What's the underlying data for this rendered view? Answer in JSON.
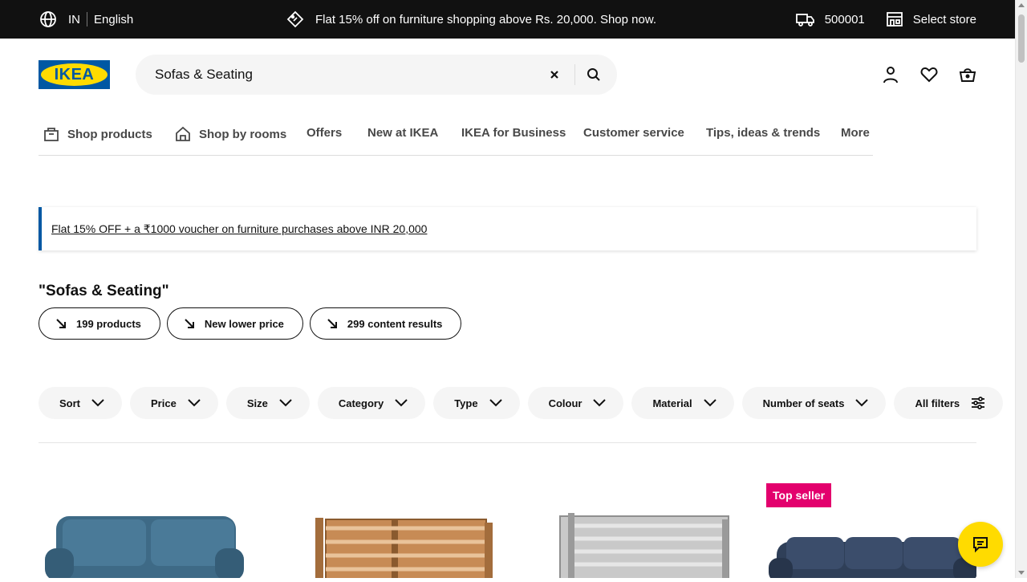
{
  "topbar": {
    "country": "IN",
    "language": "English",
    "promo": "Flat 15% off on furniture shopping above Rs. 20,000. Shop now.",
    "pincode": "500001",
    "store": "Select store"
  },
  "logo": {
    "text": "IKEA"
  },
  "search": {
    "value": "Sofas & Seating",
    "clear_icon": "close-icon",
    "search_icon": "search-icon"
  },
  "nav": {
    "items": [
      {
        "label": "Shop products"
      },
      {
        "label": "Shop by rooms"
      },
      {
        "label": "Offers"
      },
      {
        "label": "New at IKEA"
      },
      {
        "label": "IKEA for Business"
      },
      {
        "label": "Customer service"
      },
      {
        "label": "Tips, ideas & trends"
      },
      {
        "label": "More"
      }
    ]
  },
  "banner": {
    "text": "Flat 15% OFF + a ₹1000 voucher on furniture purchases above INR 20,000"
  },
  "results": {
    "title": "\"Sofas & Seating\"",
    "pills": [
      "199 products",
      "New lower price",
      "299 content results"
    ]
  },
  "filters": [
    "Sort",
    "Price",
    "Size",
    "Category",
    "Type",
    "Colour",
    "Material",
    "Number of seats",
    "All filters"
  ],
  "products": {
    "badge": "Top seller"
  },
  "colors": {
    "brand_blue": "#0058a3",
    "brand_yellow": "#ffdb00",
    "badge": "#e3006d"
  }
}
